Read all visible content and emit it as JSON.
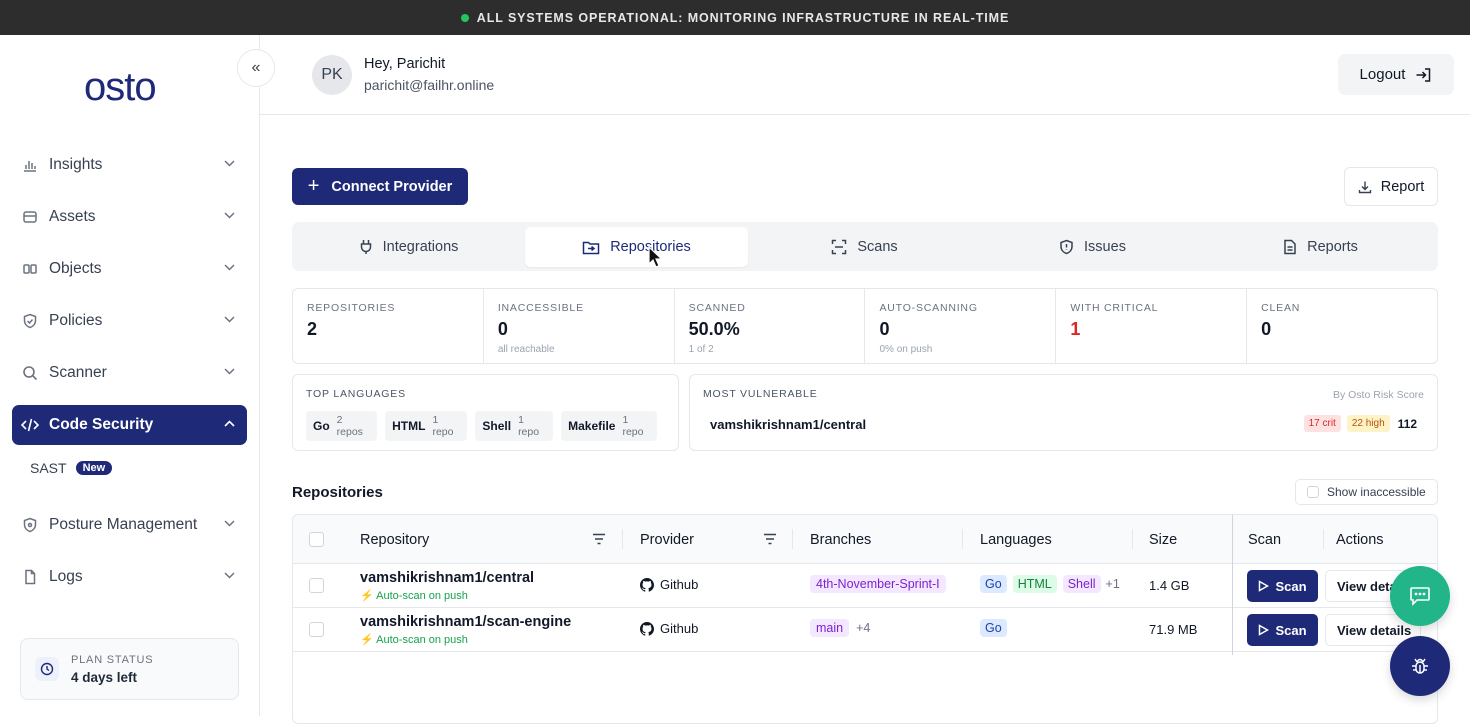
{
  "banner": {
    "text": "ALL SYSTEMS OPERATIONAL: MONITORING INFRASTRUCTURE IN REAL-TIME",
    "status_color": "#22c55e"
  },
  "brand": {
    "logo": "osto",
    "color": "#1e2a78"
  },
  "sidebar": {
    "items": [
      {
        "label": "Insights",
        "icon": "bar-chart-icon"
      },
      {
        "label": "Assets",
        "icon": "database-icon"
      },
      {
        "label": "Objects",
        "icon": "objects-icon"
      },
      {
        "label": "Policies",
        "icon": "shield-check-icon"
      },
      {
        "label": "Scanner",
        "icon": "search-icon"
      },
      {
        "label": "Code Security",
        "icon": "code-icon",
        "active": true
      },
      {
        "label": "Posture Management",
        "icon": "shield-icon"
      },
      {
        "label": "Logs",
        "icon": "file-icon"
      }
    ],
    "sub_item": {
      "label": "SAST",
      "badge": "New"
    },
    "plan": {
      "label": "PLAN STATUS",
      "value": "4 days left"
    }
  },
  "header": {
    "avatar": "PK",
    "greeting": "Hey, Parichit",
    "email": "parichit@failhr.online",
    "logout": "Logout"
  },
  "actions": {
    "connect": "Connect Provider",
    "report": "Report"
  },
  "tabs": [
    {
      "label": "Integrations",
      "icon": "plug-icon"
    },
    {
      "label": "Repositories",
      "icon": "folder-icon",
      "active": true
    },
    {
      "label": "Scans",
      "icon": "scan-icon"
    },
    {
      "label": "Issues",
      "icon": "shield-alert-icon"
    },
    {
      "label": "Reports",
      "icon": "document-icon"
    }
  ],
  "stats": [
    {
      "label": "REPOSITORIES",
      "value": "2",
      "sub": ""
    },
    {
      "label": "INACCESSIBLE",
      "value": "0",
      "sub": "all reachable"
    },
    {
      "label": "SCANNED",
      "value": "50.0%",
      "sub": "1 of 2"
    },
    {
      "label": "AUTO-SCANNING",
      "value": "0",
      "sub": "0% on push"
    },
    {
      "label": "WITH CRITICAL",
      "value": "1",
      "sub": ""
    },
    {
      "label": "CLEAN",
      "value": "0",
      "sub": ""
    }
  ],
  "top_languages": {
    "label": "TOP LANGUAGES",
    "items": [
      {
        "name": "Go",
        "count": "2 repos"
      },
      {
        "name": "HTML",
        "count": "1 repo"
      },
      {
        "name": "Shell",
        "count": "1 repo"
      },
      {
        "name": "Makefile",
        "count": "1 repo"
      }
    ]
  },
  "most_vulnerable": {
    "label": "MOST VULNERABLE",
    "note": "By Osto Risk Score",
    "repo": "vamshikrishnam1/central",
    "crit": "17 crit",
    "high": "22 high",
    "score": "112"
  },
  "repositories": {
    "title": "Repositories",
    "show_inaccessible": "Show inaccessible",
    "columns": [
      "Repository",
      "Provider",
      "Branches",
      "Languages",
      "Size",
      "Scan",
      "Actions"
    ],
    "rows": [
      {
        "name": "vamshikrishnam1/central",
        "auto": "Auto-scan on push",
        "provider": "Github",
        "branch": "4th-November-Sprint-I",
        "branch_more": "",
        "languages": [
          "Go",
          "HTML",
          "Shell"
        ],
        "lang_more": "+1",
        "size": "1.4 GB",
        "scan": "Scan",
        "view": "View details"
      },
      {
        "name": "vamshikrishnam1/scan-engine",
        "auto": "Auto-scan on push",
        "provider": "Github",
        "branch": "main",
        "branch_more": "+4",
        "languages": [
          "Go"
        ],
        "lang_more": "",
        "size": "71.9 MB",
        "scan": "Scan",
        "view": "View details"
      }
    ]
  }
}
